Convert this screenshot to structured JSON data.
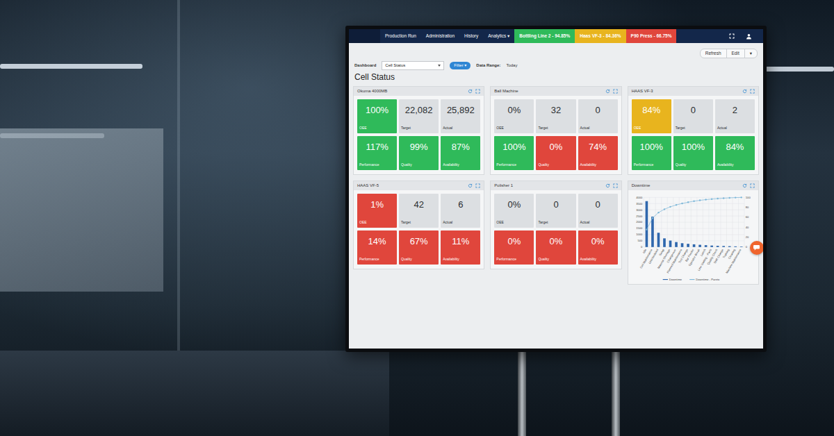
{
  "nav": {
    "items": [
      {
        "label": "Production Run"
      },
      {
        "label": "Administration"
      },
      {
        "label": "History"
      },
      {
        "label": "Analytics ▾"
      }
    ],
    "status_tabs": [
      {
        "label": "Bottling Line 2 - 94.85%",
        "color": "#2fba5a"
      },
      {
        "label": "Haas VF-3 - 84.36%",
        "color": "#e8b41e"
      },
      {
        "label": "P90 Press - 66.75%",
        "color": "#e0463c"
      }
    ]
  },
  "toolbar": {
    "buttons": [
      "Refresh",
      "Edit",
      "▾"
    ],
    "dashboard_label": "Dashboard",
    "dashboard_select": "Cell Status",
    "filter_button": "Filter ▾",
    "range_label": "Data Range:",
    "range_value": "Today"
  },
  "heading": "Cell Status",
  "cells": [
    {
      "name": "Okuma 4000MB",
      "summary": [
        {
          "value": "100%",
          "label": "OEE",
          "color": "#2fba5a"
        },
        {
          "value": "22,082",
          "label": "Target",
          "color": "#dcdfe2"
        },
        {
          "value": "25,892",
          "label": "Actual",
          "color": "#dcdfe2"
        }
      ],
      "metrics": [
        {
          "value": "117%",
          "label": "Performance",
          "color": "#2fba5a"
        },
        {
          "value": "99%",
          "label": "Quality",
          "color": "#2fba5a"
        },
        {
          "value": "87%",
          "label": "Availability",
          "color": "#2fba5a"
        }
      ]
    },
    {
      "name": "Ball Machine",
      "summary": [
        {
          "value": "0%",
          "label": "OEE",
          "color": "#dcdfe2"
        },
        {
          "value": "32",
          "label": "Target",
          "color": "#dcdfe2"
        },
        {
          "value": "0",
          "label": "Actual",
          "color": "#dcdfe2"
        }
      ],
      "metrics": [
        {
          "value": "100%",
          "label": "Performance",
          "color": "#2fba5a"
        },
        {
          "value": "0%",
          "label": "Quality",
          "color": "#e0463c"
        },
        {
          "value": "74%",
          "label": "Availability",
          "color": "#e0463c"
        }
      ]
    },
    {
      "name": "HAAS VF-3",
      "summary": [
        {
          "value": "84%",
          "label": "OEE",
          "color": "#e8b41e"
        },
        {
          "value": "0",
          "label": "Target",
          "color": "#dcdfe2"
        },
        {
          "value": "2",
          "label": "Actual",
          "color": "#dcdfe2"
        }
      ],
      "metrics": [
        {
          "value": "100%",
          "label": "Performance",
          "color": "#2fba5a"
        },
        {
          "value": "100%",
          "label": "Quality",
          "color": "#2fba5a"
        },
        {
          "value": "84%",
          "label": "Availability",
          "color": "#2fba5a"
        }
      ]
    },
    {
      "name": "HAAS VF-5",
      "summary": [
        {
          "value": "1%",
          "label": "OEE",
          "color": "#e0463c"
        },
        {
          "value": "42",
          "label": "Target",
          "color": "#dcdfe2"
        },
        {
          "value": "6",
          "label": "Actual",
          "color": "#dcdfe2"
        }
      ],
      "metrics": [
        {
          "value": "14%",
          "label": "Performance",
          "color": "#e0463c"
        },
        {
          "value": "67%",
          "label": "Quality",
          "color": "#e0463c"
        },
        {
          "value": "11%",
          "label": "Availability",
          "color": "#e0463c"
        }
      ]
    },
    {
      "name": "Polisher 1",
      "summary": [
        {
          "value": "0%",
          "label": "OEE",
          "color": "#dcdfe2"
        },
        {
          "value": "0",
          "label": "Target",
          "color": "#dcdfe2"
        },
        {
          "value": "0",
          "label": "Actual",
          "color": "#dcdfe2"
        }
      ],
      "metrics": [
        {
          "value": "0%",
          "label": "Performance",
          "color": "#e0463c"
        },
        {
          "value": "0%",
          "label": "Quality",
          "color": "#e0463c"
        },
        {
          "value": "0%",
          "label": "Availability",
          "color": "#e0463c"
        }
      ]
    }
  ],
  "chart": {
    "title": "Downtime",
    "left_ticks": [
      "0",
      "500",
      "1000",
      "1500",
      "2000",
      "2500",
      "3000",
      "3500",
      "4000"
    ],
    "right_ticks": [
      "0",
      "20",
      "40",
      "60",
      "80",
      "100"
    ],
    "categories": [
      "Idle",
      "Cell Maintenance",
      "Unscheduled",
      "Setup",
      "Material Shortage",
      "Changeover",
      "Planned Maintenance",
      "Tool Change",
      "Bar Feeder",
      "Operator Break",
      "Lunch",
      "Line Waiting - Parts",
      "Quality Check",
      "Shift Change",
      "Training",
      "Cleaning",
      "Machine Maintenance"
    ],
    "series": [
      {
        "name": "Downtime",
        "values": [
          3700,
          2450,
          1150,
          700,
          520,
          400,
          310,
          260,
          220,
          180,
          150,
          120,
          100,
          85,
          70,
          55,
          40
        ]
      },
      {
        "name": "Downtime - Pareto",
        "values": [
          35.2,
          58.5,
          69.5,
          76.1,
          81.1,
          84.9,
          87.8,
          90.3,
          92.4,
          94.1,
          95.5,
          96.7,
          97.6,
          98.4,
          99.1,
          99.6,
          100
        ]
      }
    ]
  }
}
